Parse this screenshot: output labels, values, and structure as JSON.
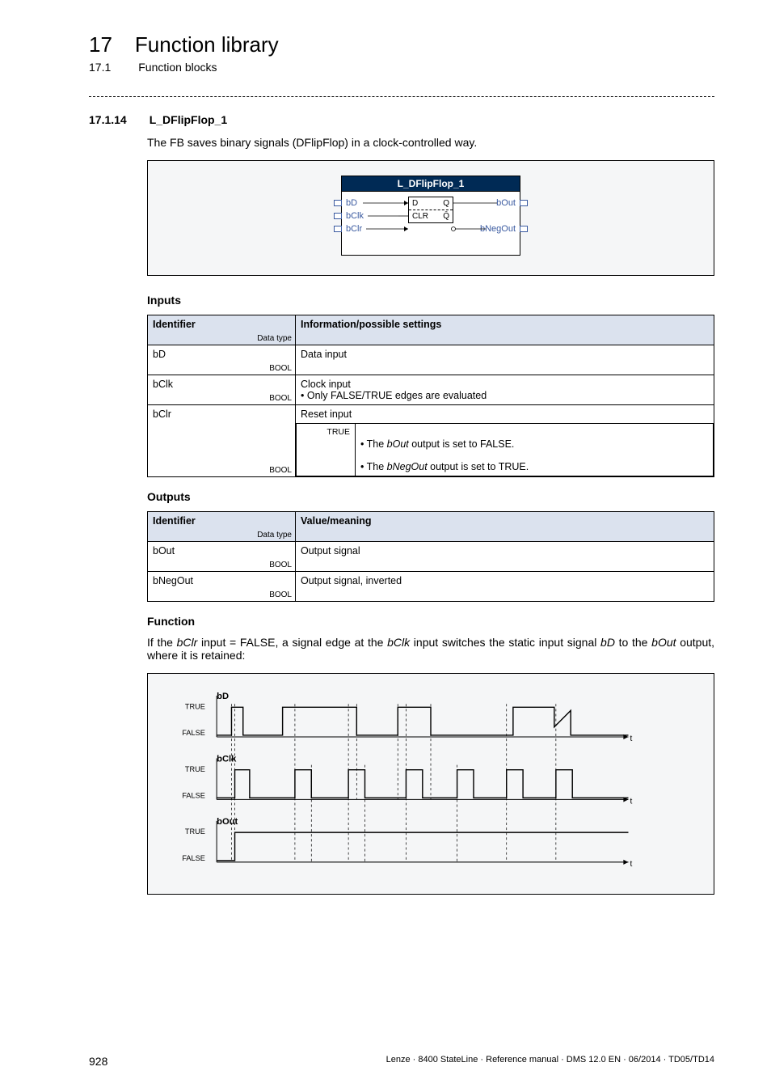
{
  "chapter": {
    "num": "17",
    "title": "Function library"
  },
  "subchapter": {
    "num": "17.1",
    "title": "Function blocks"
  },
  "section": {
    "num": "17.1.14",
    "title": "L_DFlipFlop_1"
  },
  "intro": "The FB saves binary signals (DFlipFlop) in a clock-controlled way.",
  "diagram": {
    "title": "L_DFlipFlop_1",
    "left_ports": [
      "bD",
      "bClk",
      "bClr"
    ],
    "right_ports": [
      "bOut",
      "bNegOut"
    ],
    "inner": {
      "top": [
        "D",
        "Q"
      ],
      "bottom": [
        "CLR",
        "Q̄"
      ]
    }
  },
  "inputs": {
    "heading": "Inputs",
    "header_ident": "Identifier",
    "header_dtype": "Data type",
    "header_info": "Information/possible settings",
    "rows": [
      {
        "ident": "bD",
        "dtype": "BOOL",
        "info": "Data input"
      },
      {
        "ident": "bClk",
        "dtype": "BOOL",
        "info": "Clock input\n • Only FALSE/TRUE edges are evaluated"
      },
      {
        "ident": "bClr",
        "dtype": "BOOL",
        "info_top": "Reset input",
        "sub_key": "TRUE",
        "sub_val": " • The bOut output is set to FALSE.\n • The bNegOut output is set to TRUE."
      }
    ]
  },
  "outputs": {
    "heading": "Outputs",
    "header_ident": "Identifier",
    "header_dtype": "Data type",
    "header_info": "Value/meaning",
    "rows": [
      {
        "ident": "bOut",
        "dtype": "BOOL",
        "info": "Output signal"
      },
      {
        "ident": "bNegOut",
        "dtype": "BOOL",
        "info": "Output signal, inverted"
      }
    ]
  },
  "func": {
    "heading": "Function",
    "text_pre": "If the ",
    "bclr": "bClr",
    "text_mid1": " input = FALSE, a signal edge at the ",
    "bclk": "bClk",
    "text_mid2": " input switches the static input signal ",
    "bd": "bD",
    "text_mid3": " to the ",
    "bout": "bOut",
    "text_end": " output, where it is retained:"
  },
  "wave": {
    "labels": {
      "bD": "bD",
      "bClk": "bClk",
      "bOut": "bOut",
      "TRUE": "TRUE",
      "FALSE": "FALSE",
      "t": "t"
    }
  },
  "footer": {
    "page": "928",
    "doc": "Lenze · 8400 StateLine · Reference manual · DMS 12.0 EN · 06/2014 · TD05/TD14"
  }
}
